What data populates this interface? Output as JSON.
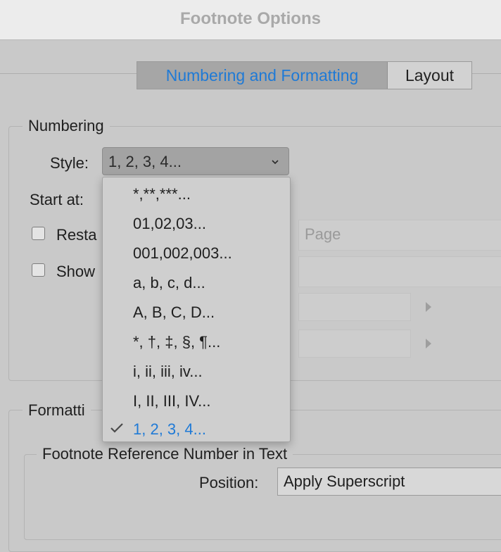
{
  "window": {
    "title": "Footnote Options"
  },
  "tabs": [
    {
      "label": "Numbering and Formatting",
      "active": true
    },
    {
      "label": "Layout",
      "active": false
    }
  ],
  "numbering": {
    "group_label": "Numbering",
    "style_label": "Style:",
    "style_value": "1, 2, 3, 4...",
    "start_at_label": "Start at:",
    "restart_label": "Resta",
    "show_label": "Show",
    "restart_every_value": "Page"
  },
  "dropdown": {
    "options": [
      "*,**,***...",
      "01,02,03...",
      "001,002,003...",
      "a, b, c, d...",
      "A, B, C, D...",
      "*, †, ‡, §, ¶...",
      "i, ii, iii, iv...",
      "I, II, III, IV...",
      "1, 2, 3, 4..."
    ],
    "selected_index": 8
  },
  "formatting": {
    "group_label": "Formatti",
    "subgroup_label": "Footnote Reference Number in Text",
    "position_label": "Position:",
    "position_value": "Apply Superscript"
  },
  "colors": {
    "accent": "#1f7ad6",
    "background": "#c9c9c9",
    "titlebar": "#ececec"
  }
}
